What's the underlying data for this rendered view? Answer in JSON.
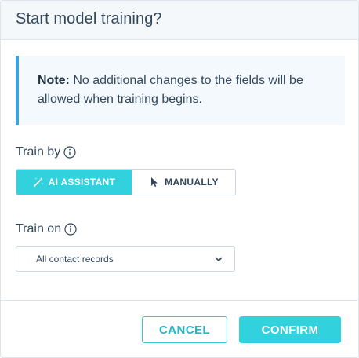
{
  "dialog": {
    "title": "Start model training?"
  },
  "note": {
    "strong": "Note:",
    "text": " No additional changes to the fields will be allowed when training begins."
  },
  "train_by": {
    "label": "Train by",
    "options": [
      {
        "label": "AI ASSISTANT",
        "icon": "magic-wand-icon",
        "selected": true
      },
      {
        "label": "MANUALLY",
        "icon": "cursor-pointer-icon",
        "selected": false
      }
    ]
  },
  "train_on": {
    "label": "Train on",
    "selected": "All contact records"
  },
  "footer": {
    "cancel_label": "CANCEL",
    "confirm_label": "CONFIRM"
  },
  "colors": {
    "accent": "#32d1de",
    "note_border": "#3ea3dd",
    "text": "#33475b"
  }
}
